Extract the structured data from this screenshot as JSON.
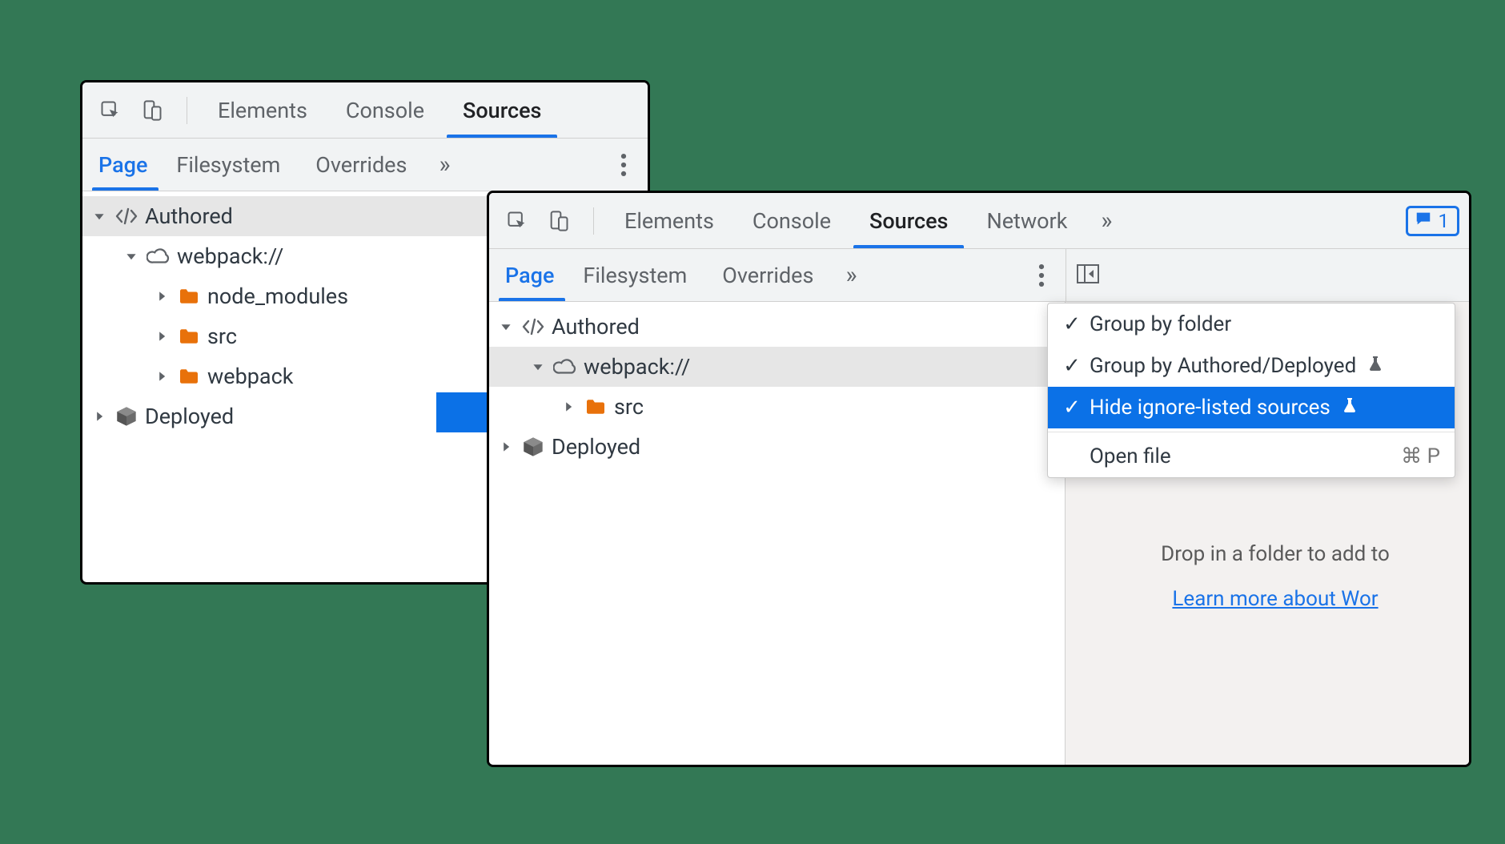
{
  "colors": {
    "accent": "#1a73e8",
    "folder": "#f39c12",
    "bg": "#337855"
  },
  "panel_left": {
    "tabs": [
      "Elements",
      "Console",
      "Sources"
    ],
    "active_tab": "Sources",
    "subtabs": [
      "Page",
      "Filesystem",
      "Overrides"
    ],
    "active_subtab": "Page",
    "tree": {
      "authored_label": "Authored",
      "webpack_label": "webpack://",
      "folders": [
        "node_modules",
        "src",
        "webpack"
      ],
      "deployed_label": "Deployed"
    }
  },
  "panel_right": {
    "tabs": [
      "Elements",
      "Console",
      "Sources",
      "Network"
    ],
    "active_tab": "Sources",
    "badge_count": "1",
    "subtabs": [
      "Page",
      "Filesystem",
      "Overrides"
    ],
    "active_subtab": "Page",
    "tree": {
      "authored_label": "Authored",
      "webpack_label": "webpack://",
      "folders": [
        "src"
      ],
      "deployed_label": "Deployed"
    },
    "context_menu": {
      "items": [
        {
          "check": true,
          "label": "Group by folder",
          "flask": false
        },
        {
          "check": true,
          "label": "Group by Authored/Deployed",
          "flask": true
        },
        {
          "check": true,
          "label": "Hide ignore-listed sources",
          "flask": true,
          "hilite": true
        }
      ],
      "open_file_label": "Open file",
      "open_file_shortcut": "⌘ P"
    },
    "drop_hint": "Drop in a folder to add to",
    "learn_more": "Learn more about Wor"
  }
}
